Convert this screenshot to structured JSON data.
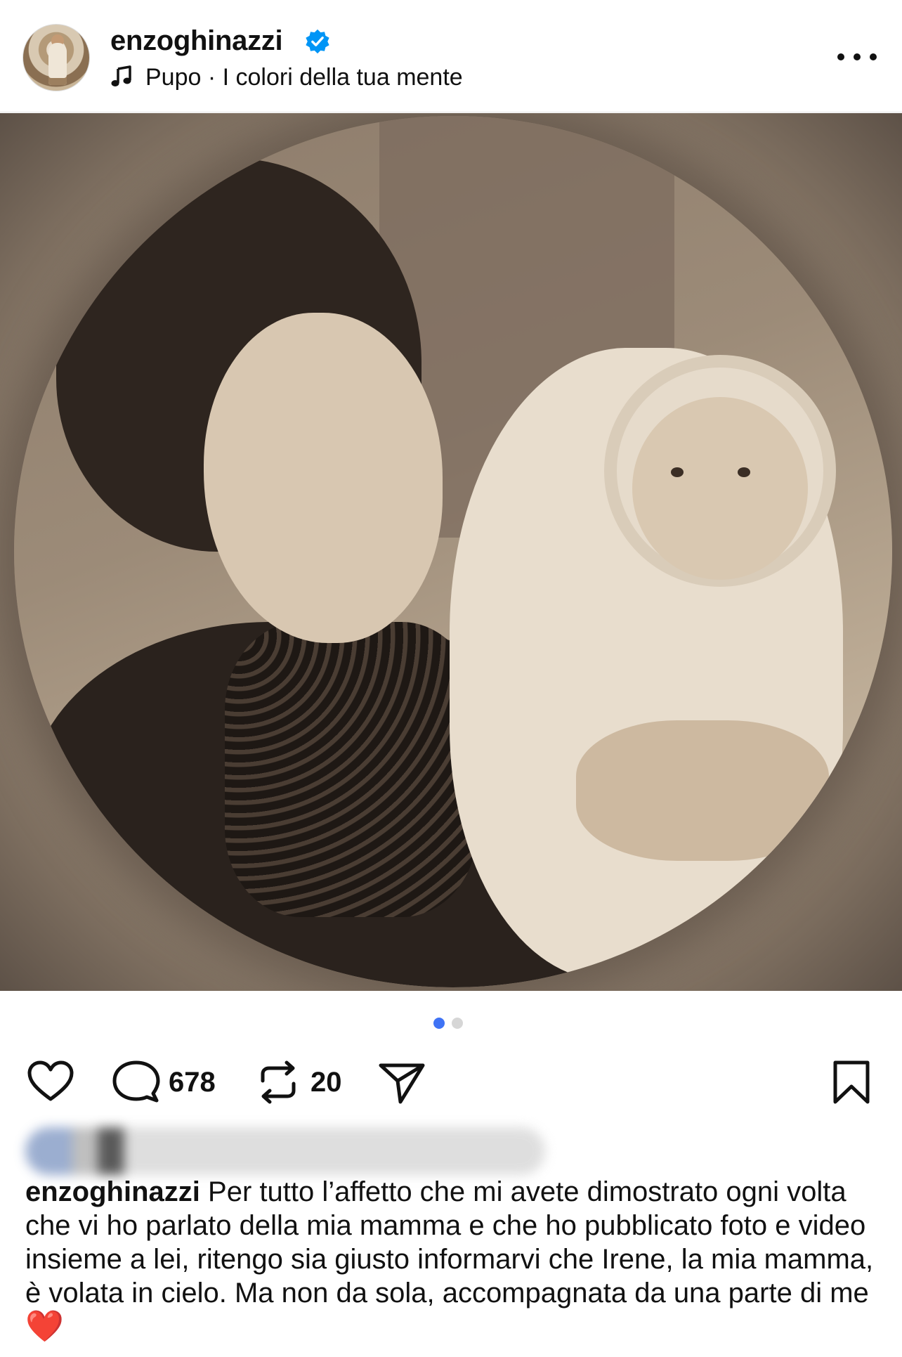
{
  "post": {
    "username": "enzoghinazzi",
    "verified": true,
    "music": "Pupo · I colori della tua mente",
    "carousel_slides": 2,
    "carousel_active_index": 0,
    "sound_muted": true
  },
  "actions": {
    "comments_count": "678",
    "reposts_count": "20"
  },
  "caption": {
    "user": "enzoghinazzi",
    "text": "Per tutto l’affetto che mi avete dimostrato ogni volta che vi ho parlato della mia mamma e che ho pubblicato foto e video insieme a lei, ritengo sia giusto informarvi che Irene, la mia mamma, è volata in cielo. Ma non da sola, accompagnata da una parte di me",
    "emoji": "❤️"
  },
  "icons": {
    "header": [
      "avatar",
      "verified-badge-icon",
      "music-note-icon",
      "more-options-icon"
    ],
    "media": [
      "sound-off-icon"
    ],
    "actions": [
      "heart-icon",
      "comment-icon",
      "repost-icon",
      "share-icon",
      "bookmark-icon"
    ]
  },
  "colors": {
    "accent_blue": "#3f73f5",
    "verified_blue": "#0095f6",
    "heart_red": "#e0243c",
    "text": "#111111"
  }
}
